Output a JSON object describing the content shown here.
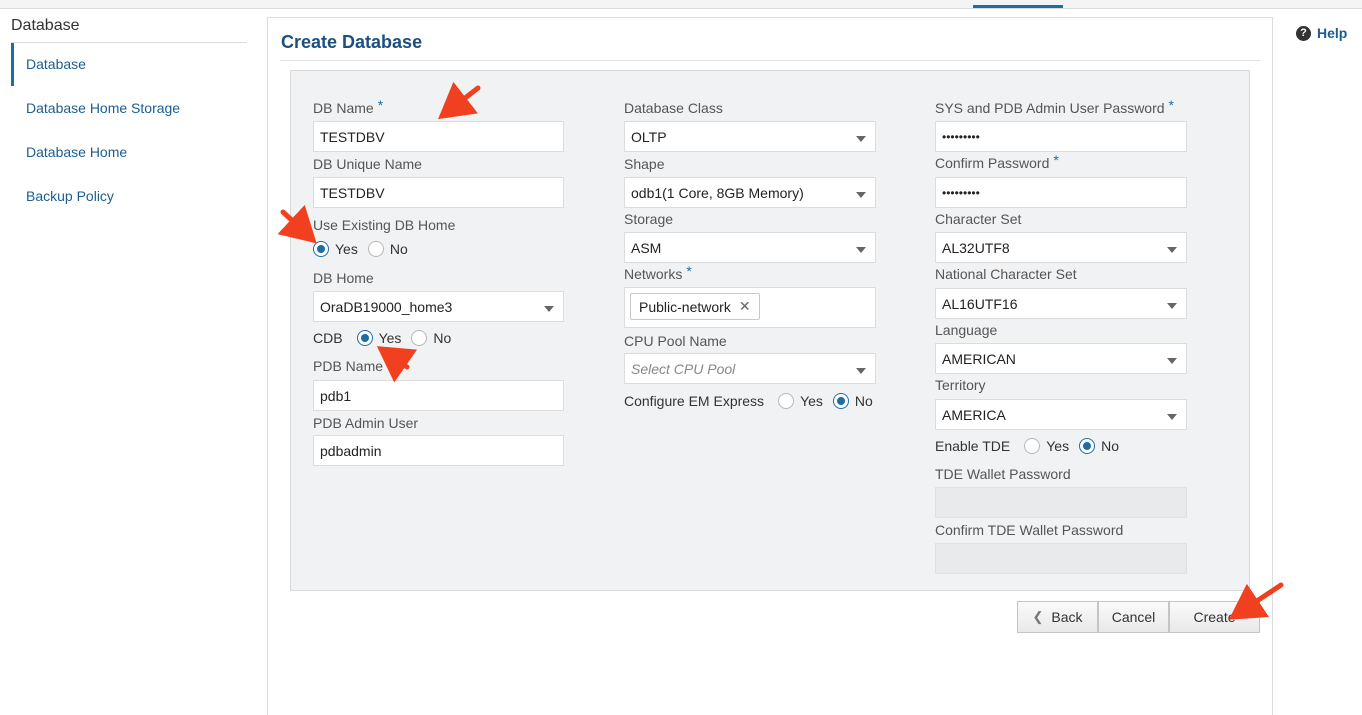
{
  "sidebar": {
    "title": "Database",
    "items": [
      {
        "label": "Database"
      },
      {
        "label": "Database Home Storage"
      },
      {
        "label": "Database Home"
      },
      {
        "label": "Backup Policy"
      }
    ]
  },
  "help": {
    "label": "Help",
    "icon": "question-circle-icon"
  },
  "page": {
    "title": "Create Database"
  },
  "col1": {
    "db_name": {
      "label": "DB Name",
      "required": "*",
      "value": "TESTDBV"
    },
    "db_unique_name": {
      "label": "DB Unique Name",
      "value": "TESTDBV"
    },
    "use_existing_home": {
      "label": "Use Existing DB Home",
      "yes": "Yes",
      "no": "No",
      "selected": "Yes"
    },
    "db_home": {
      "label": "DB Home",
      "value": "OraDB19000_home3"
    },
    "cdb": {
      "label": "CDB",
      "yes": "Yes",
      "no": "No",
      "selected": "Yes"
    },
    "pdb_name": {
      "label": "PDB Name",
      "required": "*",
      "value": "pdb1"
    },
    "pdb_admin_user": {
      "label": "PDB Admin User",
      "value": "pdbadmin"
    }
  },
  "col2": {
    "database_class": {
      "label": "Database Class",
      "value": "OLTP"
    },
    "shape": {
      "label": "Shape",
      "value": "odb1(1 Core, 8GB Memory)"
    },
    "storage": {
      "label": "Storage",
      "value": "ASM"
    },
    "networks": {
      "label": "Networks",
      "required": "*",
      "chip": "Public-network",
      "chip_remove": "✕"
    },
    "cpu_pool": {
      "label": "CPU Pool Name",
      "placeholder": "Select CPU Pool"
    },
    "em_express": {
      "label": "Configure EM Express",
      "yes": "Yes",
      "no": "No",
      "selected": "No"
    }
  },
  "col3": {
    "sys_password": {
      "label": "SYS and PDB Admin User Password",
      "required": "*",
      "value": "•••••••••"
    },
    "confirm_password": {
      "label": "Confirm Password",
      "required": "*",
      "value": "•••••••••"
    },
    "character_set": {
      "label": "Character Set",
      "value": "AL32UTF8"
    },
    "national_character_set": {
      "label": "National Character Set",
      "value": "AL16UTF16"
    },
    "language": {
      "label": "Language",
      "value": "AMERICAN"
    },
    "territory": {
      "label": "Territory",
      "value": "AMERICA"
    },
    "enable_tde": {
      "label": "Enable TDE",
      "yes": "Yes",
      "no": "No",
      "selected": "No"
    },
    "tde_wallet_password": {
      "label": "TDE Wallet Password",
      "value": ""
    },
    "confirm_tde_wallet_password": {
      "label": "Confirm TDE Wallet Password",
      "value": ""
    }
  },
  "buttons": {
    "back": "Back",
    "cancel": "Cancel",
    "create": "Create"
  },
  "colors": {
    "accent": "#1c6ea4",
    "title": "#1c4f80",
    "annotation_arrow": "#f0401f"
  }
}
